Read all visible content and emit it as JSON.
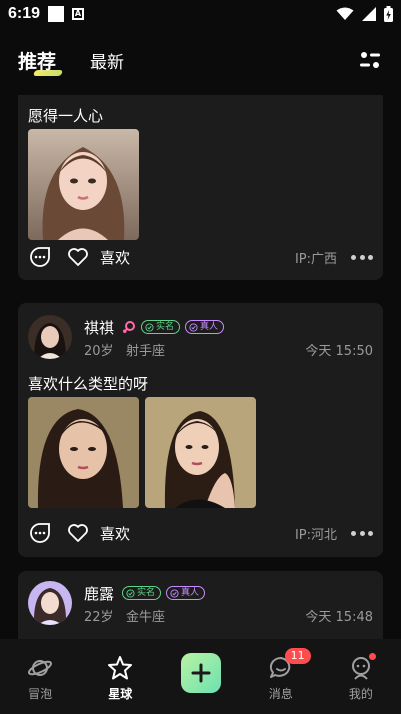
{
  "status_bar": {
    "time": "6:19",
    "a_label": "A"
  },
  "top_nav": {
    "tabs": [
      {
        "label": "推荐",
        "active": true
      },
      {
        "label": "最新",
        "active": false
      }
    ]
  },
  "posts": [
    {
      "text": "愿得一人心",
      "like_label": "喜欢",
      "ip": "IP:广西"
    },
    {
      "user": {
        "name": "祺祺",
        "age": "20岁",
        "zodiac": "射手座"
      },
      "badges": {
        "verified": "实名",
        "real": "真人"
      },
      "time": "今天 15:50",
      "text": "喜欢什么类型的呀",
      "like_label": "喜欢",
      "ip": "IP:河北"
    },
    {
      "user": {
        "name": "鹿露",
        "age": "22岁",
        "zodiac": "金牛座"
      },
      "badges": {
        "verified": "实名",
        "real": "真人"
      },
      "time": "今天 15:48"
    }
  ],
  "bottom_nav": {
    "items": [
      {
        "label": "冒泡",
        "icon": "planet-icon"
      },
      {
        "label": "星球",
        "icon": "star-icon"
      },
      {
        "label": "",
        "icon": "plus-icon"
      },
      {
        "label": "消息",
        "icon": "chat-bubble-icon",
        "badge": "11"
      },
      {
        "label": "我的",
        "icon": "profile-icon",
        "dot": true
      }
    ]
  },
  "colors": {
    "accent": "#6de0b0",
    "verified": "#5fd38a",
    "real": "#c88cff",
    "badge_red": "#ff4d4f",
    "card_bg": "#1c1c1c"
  }
}
